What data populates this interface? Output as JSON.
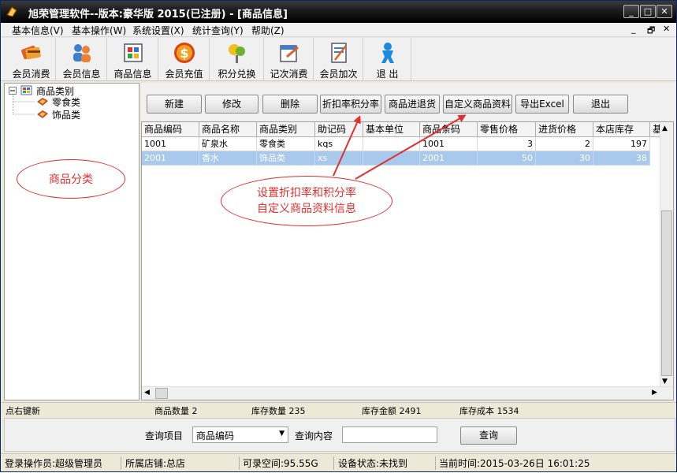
{
  "window": {
    "title": "旭荣管理软件--版本:豪华版 2015(已注册) - [商品信息]",
    "controls": [
      "_",
      "□",
      "✕"
    ]
  },
  "menu": {
    "items": [
      "基本信息(V)",
      "基本操作(W)",
      "系统设置(X)",
      "统计查询(Y)",
      "帮助(Z)"
    ],
    "mdi_controls": [
      "_",
      "🗗",
      "✕"
    ]
  },
  "toolbar": {
    "items": [
      {
        "label": "会员消费",
        "icon": "member-consume-icon"
      },
      {
        "label": "会员信息",
        "icon": "member-info-icon"
      },
      {
        "label": "商品信息",
        "icon": "product-info-icon"
      },
      {
        "label": "会员充值",
        "icon": "recharge-icon"
      },
      {
        "label": "积分兑换",
        "icon": "points-exchange-icon"
      },
      {
        "label": "记次消费",
        "icon": "count-consume-icon"
      },
      {
        "label": "会员加次",
        "icon": "add-count-icon"
      },
      {
        "label": "退 出",
        "icon": "exit-icon"
      }
    ]
  },
  "tree": {
    "root": "商品类别",
    "children": [
      "零食类",
      "饰品类"
    ]
  },
  "annotations": {
    "left_note": "商品分类",
    "right_note_line1": "设置折扣率和积分率",
    "right_note_line2": "自定义商品资料信息",
    "accent_color": "#e03030"
  },
  "actions": [
    "新建",
    "修改",
    "删除",
    "折扣率积分率",
    "商品进退货",
    "自定义商品资料",
    "导出Excel",
    "退出"
  ],
  "table": {
    "columns": [
      "商品编码",
      "商品名称",
      "商品类别",
      "助记码",
      "基本单位",
      "商品条码",
      "零售价格",
      "进货价格",
      "本店库存",
      "基"
    ],
    "rows": [
      [
        "1001",
        "矿泉水",
        "零食类",
        "kqs",
        "",
        "1001",
        "3",
        "2",
        "197"
      ],
      [
        "2001",
        "香水",
        "饰品类",
        "xs",
        "",
        "2001",
        "50",
        "30",
        "38"
      ]
    ],
    "selected_row": 1
  },
  "summary": {
    "hint": "点右键新",
    "product_count": "商品数量 2",
    "stock_qty": "库存数量 235",
    "stock_amount": "库存金额 2491",
    "stock_cost": "库存成本 1534"
  },
  "query": {
    "item_label": "查询项目",
    "item_value": "商品编码",
    "content_label": "查询内容",
    "content_value": "",
    "button": "查询"
  },
  "status": {
    "operator": "登录操作员:超级管理员",
    "store": "所属店铺:总店",
    "space": "可录空间:95.55G",
    "device": "设备状态:未找到",
    "time": "当前时间:2015-03-26日 16:01:25"
  }
}
